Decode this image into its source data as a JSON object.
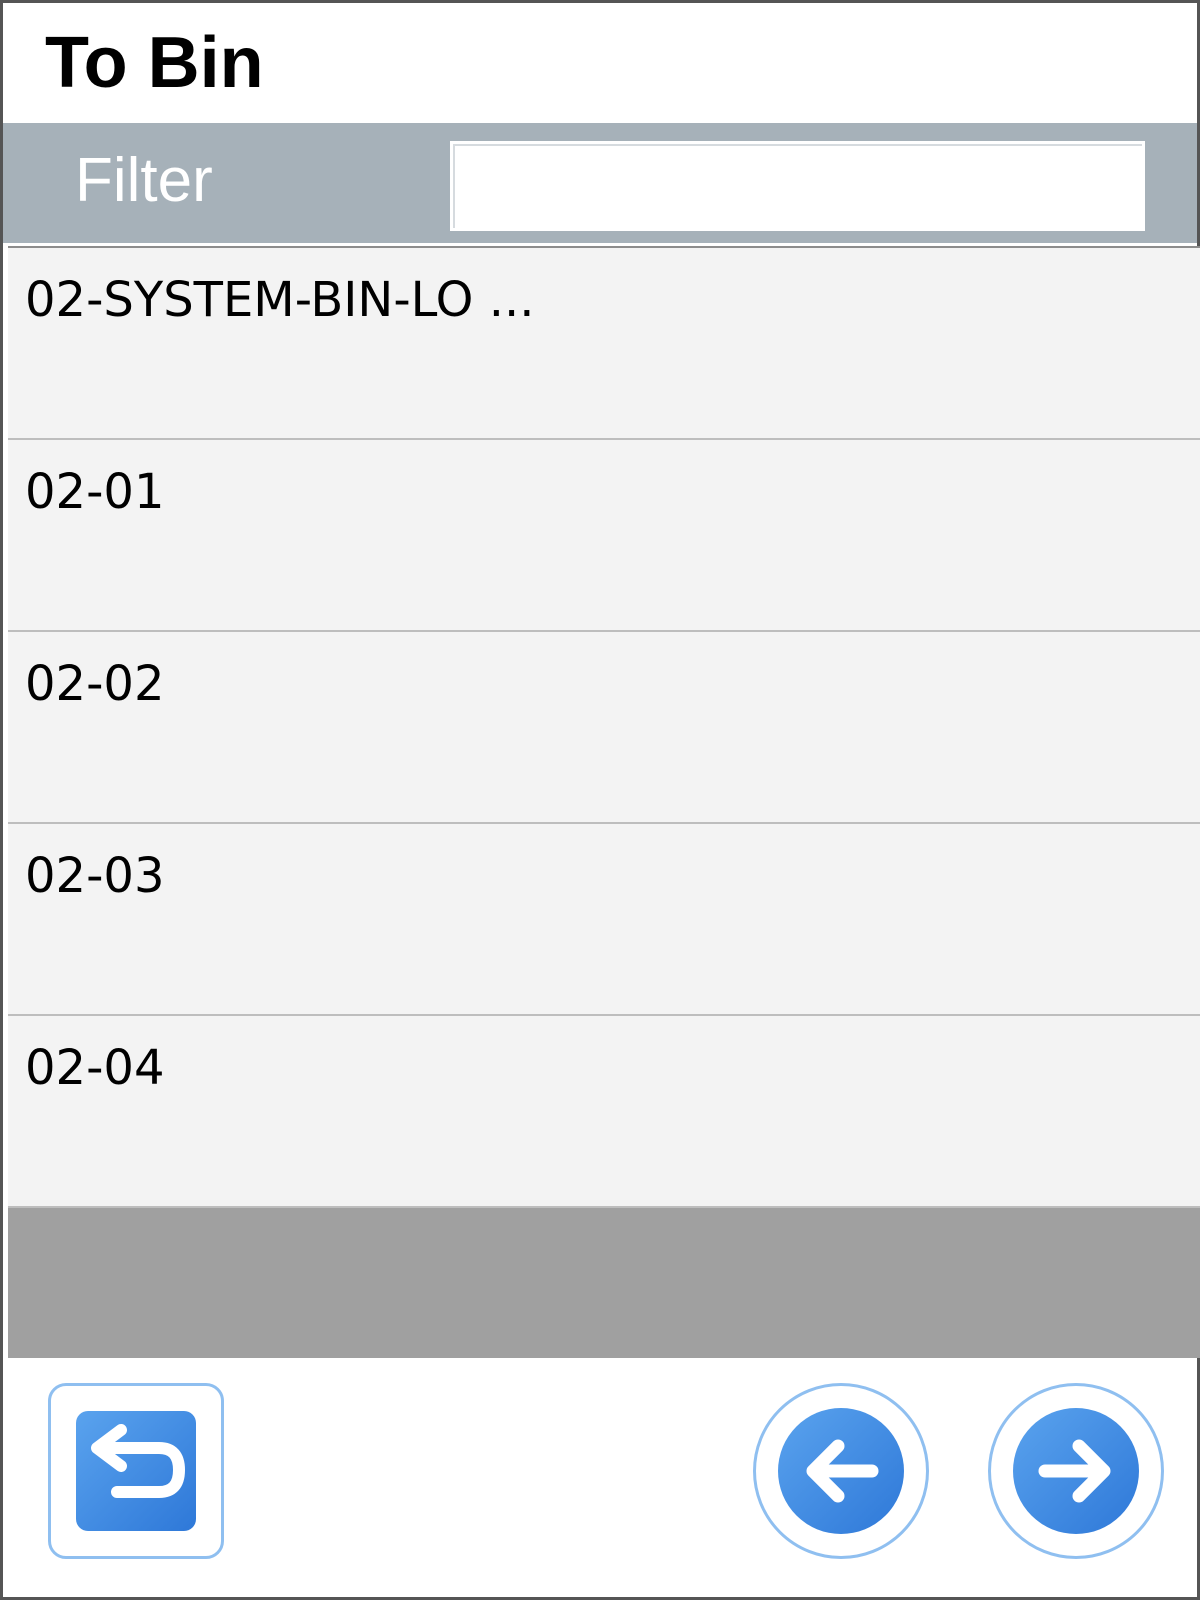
{
  "header": {
    "title": "To Bin"
  },
  "filter": {
    "label": "Filter",
    "value": "",
    "placeholder": ""
  },
  "bins": {
    "items": [
      {
        "label": "02-SYSTEM-BIN-LO ..."
      },
      {
        "label": "02-01"
      },
      {
        "label": "02-02"
      },
      {
        "label": "02-03"
      },
      {
        "label": "02-04"
      }
    ]
  },
  "footer": {
    "back_icon": "return-arrow-icon",
    "prev_icon": "arrow-left-icon",
    "next_icon": "arrow-right-icon"
  },
  "colors": {
    "filter_bar": "#a6b1b9",
    "list_item_bg": "#f3f3f3",
    "list_empty_bg": "#a0a0a0",
    "button_accent": "#3b8be3",
    "button_border": "#8fbff0"
  }
}
